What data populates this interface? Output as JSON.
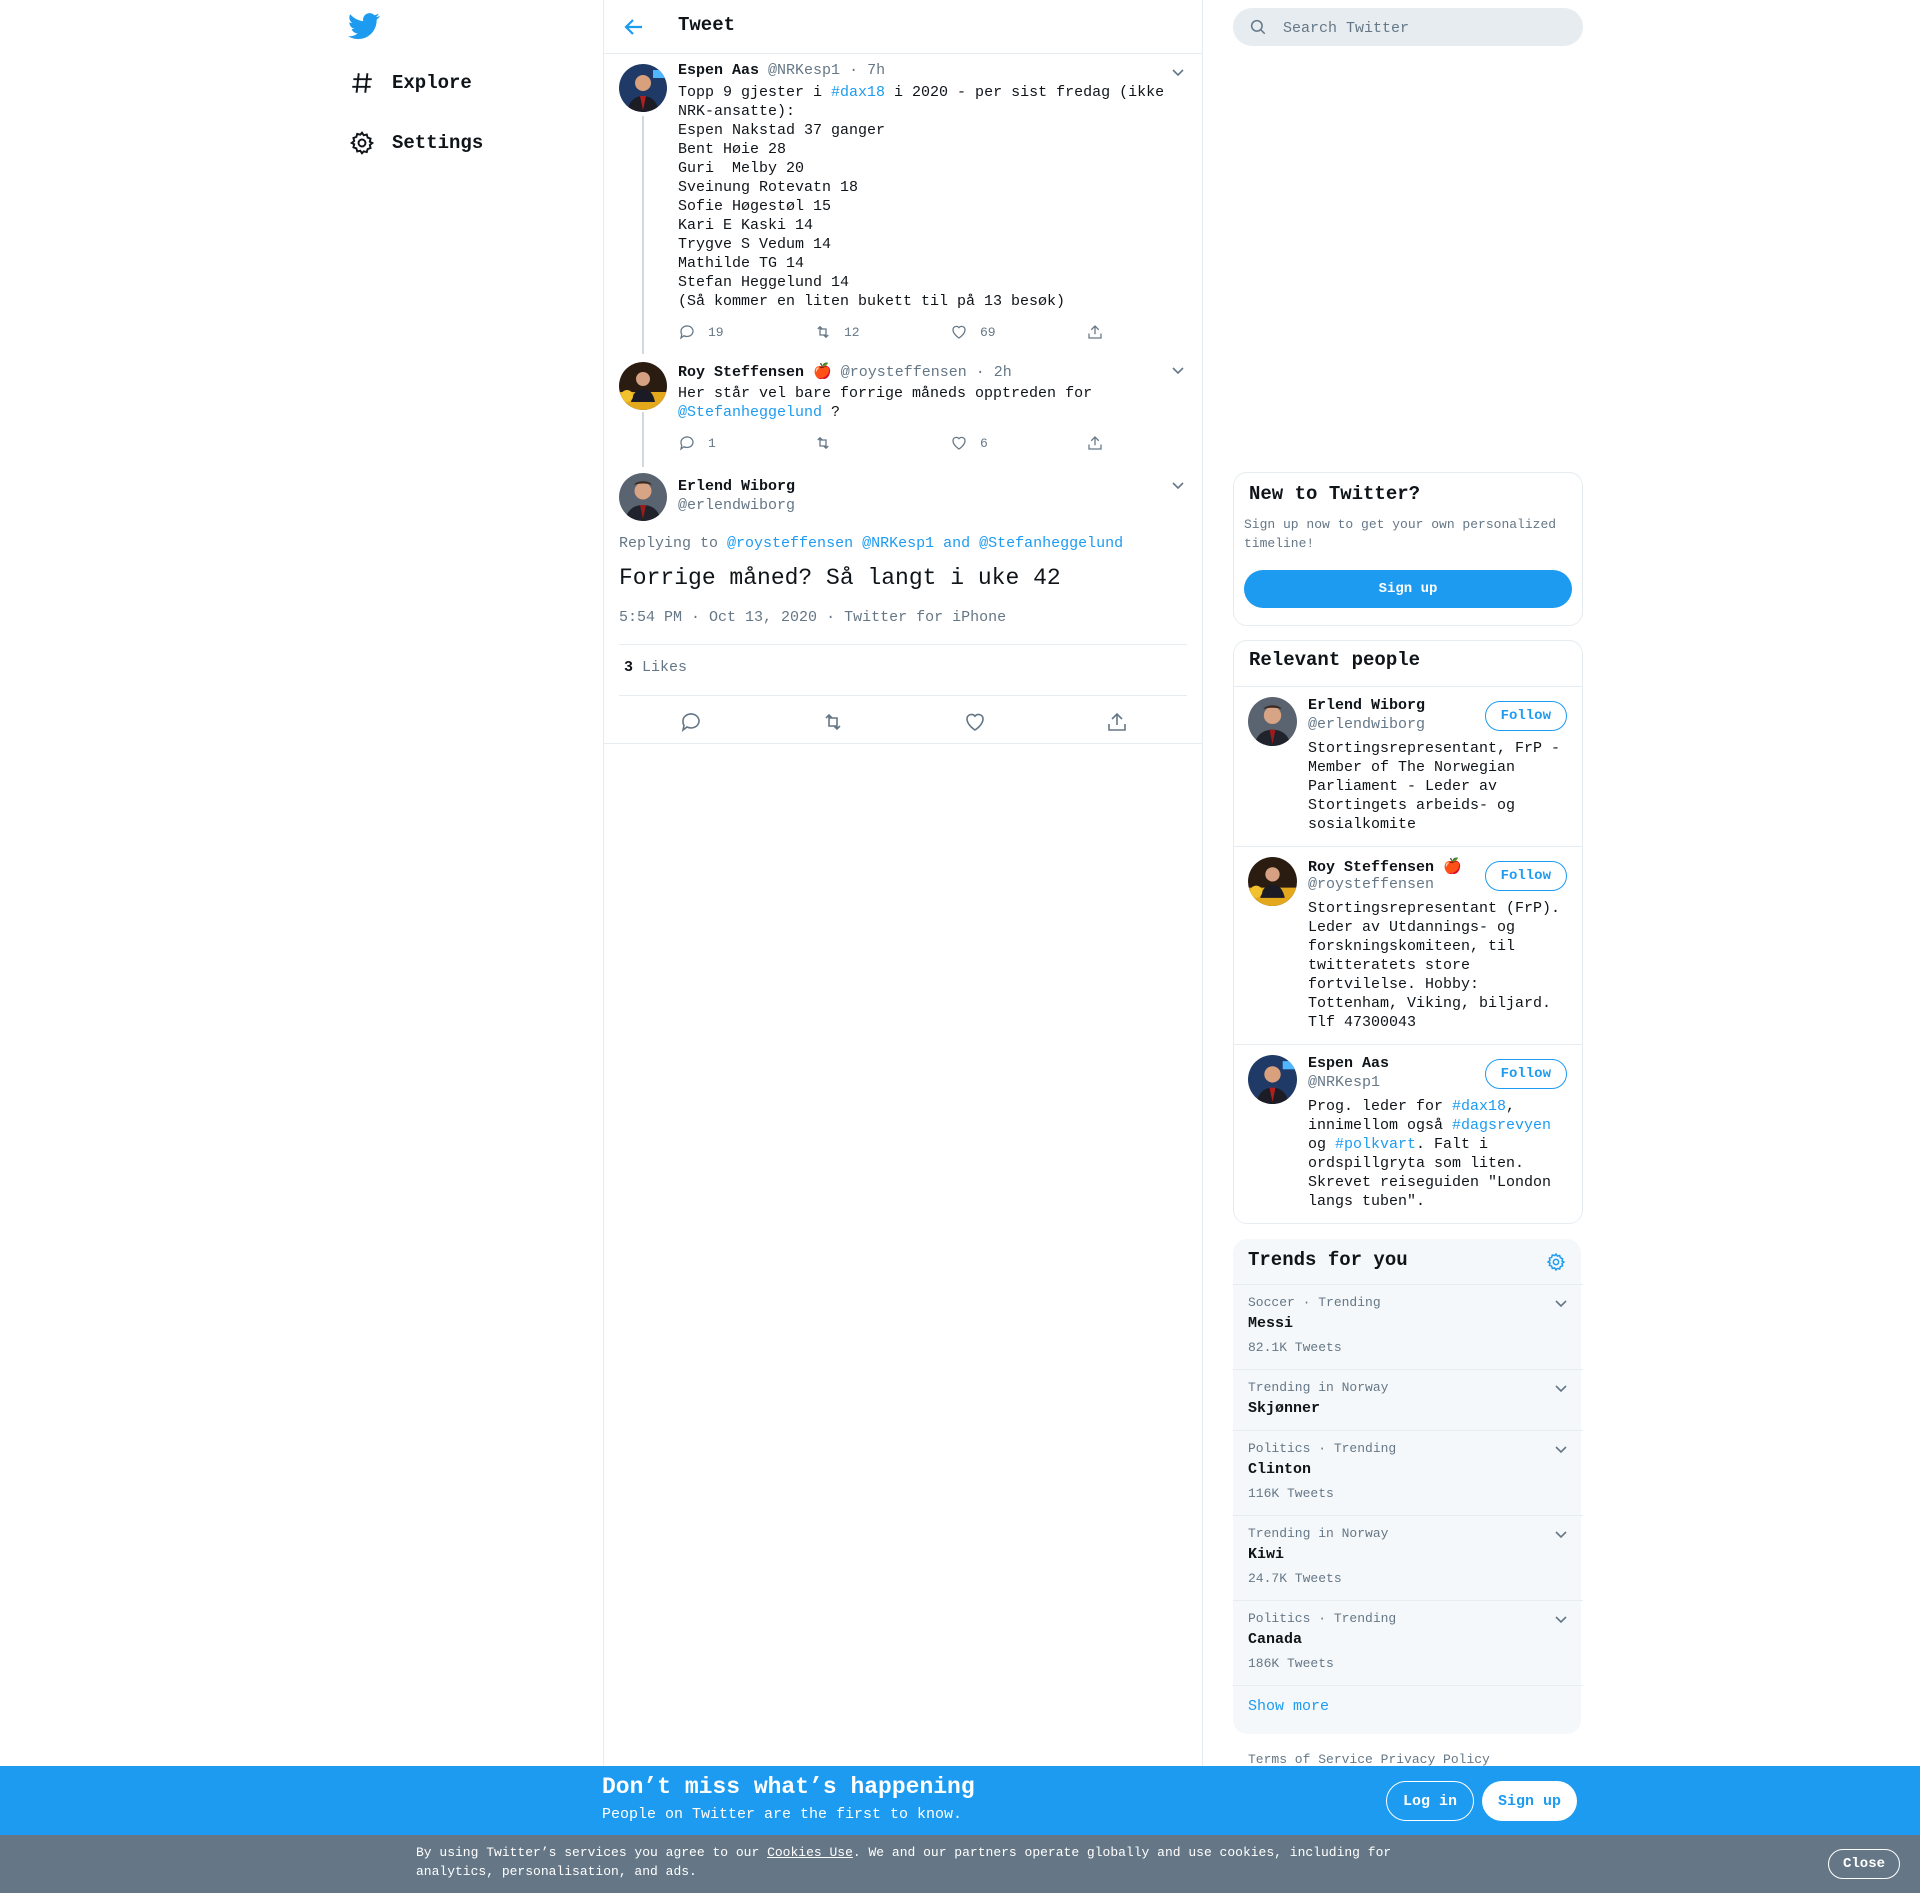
{
  "nav": {
    "items": [
      {
        "label": "Explore",
        "icon": "hashtag-icon"
      },
      {
        "label": "Settings",
        "icon": "gear-icon"
      }
    ]
  },
  "header": {
    "title": "Tweet"
  },
  "thread": [
    {
      "name": "Espen Aas",
      "handle": "@NRKesp1",
      "time": "· 7h",
      "text_pre": "Topp 9 gjester i ",
      "hashtag": "#dax18",
      "text_post": " i 2020 - per sist fredag (ikke NRK-ansatte):\nEspen Nakstad 37 ganger\nBent Høie 28\nGuri  Melby 20\nSveinung Rotevatn 18\nSofie Høgestøl 15\nKari E Kaski 14\nTrygve S Vedum 14\nMathilde TG 14\nStefan Heggelund 14\n(Så kommer en liten bukett til på 13 besøk)",
      "replies": "19",
      "retweets": "12",
      "likes": "69"
    },
    {
      "name": "Roy Steffensen",
      "emoji": "🍎",
      "handle": "@roysteffensen",
      "time": "· 2h",
      "text_pre": "Her står vel bare forrige måneds opptreden for ",
      "mention": "@Stefanheggelund",
      "text_post": " ?",
      "replies": "1",
      "retweets": "",
      "likes": "6"
    }
  ],
  "focus": {
    "name": "Erlend Wiborg",
    "handle": "@erlendwiborg",
    "replying_label": "Replying to",
    "replying_to": [
      "@roysteffensen",
      "@NRKesp1",
      "and",
      "@Stefanheggelund"
    ],
    "text": "Forrige måned? Så langt i uke 42",
    "timestamp": "5:54 PM · Oct 13, 2020",
    "source": "· Twitter for iPhone",
    "likes_count": "3",
    "likes_label": "Likes"
  },
  "search": {
    "placeholder": "Search Twitter"
  },
  "new_to_twitter": {
    "title": "New to Twitter?",
    "description": "Sign up now to get your own personalized timeline!",
    "button": "Sign up"
  },
  "relevant_people": {
    "title": "Relevant people",
    "follow_label": "Follow",
    "people": [
      {
        "name": "Erlend Wiborg",
        "handle": "@erlendwiborg",
        "bio": "Stortingsrepresentant, FrP - Member of The Norwegian Parliament - Leder av Stortingets arbeids- og sosialkomite"
      },
      {
        "name": "Roy Steffensen",
        "emoji": "🍎",
        "handle": "@roysteffensen",
        "bio": "Stortingsrepresentant (FrP). Leder av Utdannings- og forskningskomiteen, til twitteratets store fortvilelse. Hobby: Tottenham, Viking, biljard. Tlf 47300043"
      },
      {
        "name": "Espen Aas",
        "handle": "@NRKesp1",
        "bio_1": "Prog. leder for ",
        "bio_tag1": "#dax18",
        "bio_2": ", innimellom også ",
        "bio_tag2": "#dagsrevyen",
        "bio_3": " og ",
        "bio_tag3": "#polkvart",
        "bio_4": ". Falt i ordspillgryta som liten. Skrevet reiseguiden \"London langs tuben\"."
      }
    ]
  },
  "trends": {
    "title": "Trends for you",
    "items": [
      {
        "meta": "Soccer · Trending",
        "name": "Messi",
        "count": "82.1K Tweets"
      },
      {
        "meta": "Trending in Norway",
        "name": "Skjønner",
        "count": ""
      },
      {
        "meta": "Politics · Trending",
        "name": "Clinton",
        "count": "116K Tweets"
      },
      {
        "meta": "Trending in Norway",
        "name": "Kiwi",
        "count": "24.7K Tweets"
      },
      {
        "meta": "Politics · Trending",
        "name": "Canada",
        "count": "186K Tweets"
      }
    ],
    "show_more": "Show more"
  },
  "footer": {
    "terms": "Terms of Service",
    "privacy": "Privacy Policy"
  },
  "promo": {
    "title": "Don’t miss what’s happening",
    "subtitle": "People on Twitter are the first to know.",
    "login": "Log in",
    "signup": "Sign up"
  },
  "cookie": {
    "text_pre": "By using Twitter’s services you agree to our ",
    "link": "Cookies Use",
    "text_post": ". We and our partners operate globally and use cookies, including for analytics, personalisation, and ads.",
    "close": "Close"
  },
  "colors": {
    "accent": "#1d9bf0",
    "muted": "#657786",
    "cookie_bar": "#657786"
  }
}
